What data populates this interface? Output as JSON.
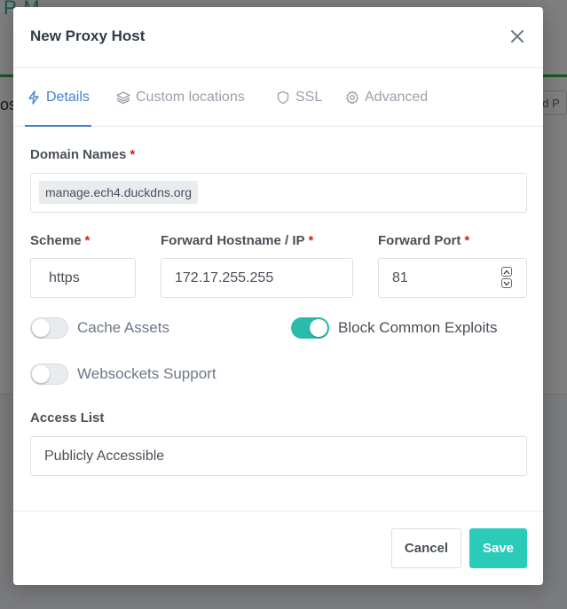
{
  "background": {
    "brand": "P     M",
    "side_text": "os",
    "add_button": "dd P"
  },
  "modal": {
    "title": "New Proxy Host",
    "close_icon": "close-icon"
  },
  "tabs": [
    {
      "label": "Details",
      "icon": "bolt-icon",
      "active": true
    },
    {
      "label": "Custom locations",
      "icon": "layers-icon",
      "active": false
    },
    {
      "label": "SSL",
      "icon": "shield-icon",
      "active": false
    },
    {
      "label": "Advanced",
      "icon": "gear-icon",
      "active": false
    }
  ],
  "form": {
    "domain_names": {
      "label": "Domain Names",
      "required_mark": "*",
      "chips": [
        "manage.ech4.duckdns.org"
      ]
    },
    "scheme": {
      "label": "Scheme",
      "required_mark": "*",
      "value": "https"
    },
    "forward_host": {
      "label": "Forward Hostname / IP",
      "required_mark": "*",
      "value": "172.17.255.255"
    },
    "forward_port": {
      "label": "Forward Port",
      "required_mark": "*",
      "value": "81"
    },
    "toggles": {
      "cache_assets": {
        "label": "Cache Assets",
        "on": false
      },
      "block_exploits": {
        "label": "Block Common Exploits",
        "on": true
      },
      "websockets": {
        "label": "Websockets Support",
        "on": false
      }
    },
    "access_list": {
      "label": "Access List",
      "value": "Publicly Accessible"
    }
  },
  "footer": {
    "cancel_label": "Cancel",
    "save_label": "Save"
  },
  "colors": {
    "accent": "#467fcf",
    "toggle_on": "#2bbbad",
    "save_button": "#2bcbba",
    "required": "#cd201f"
  }
}
